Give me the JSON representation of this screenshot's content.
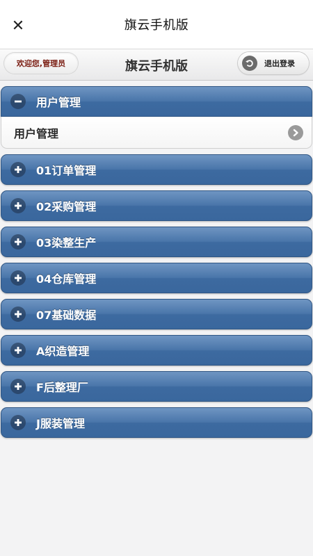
{
  "topbar": {
    "close_symbol": "✕",
    "title": "旗云手机版"
  },
  "header": {
    "welcome": "欢迎您,管理员",
    "title": "旗云手机版",
    "logout_label": "退出登录"
  },
  "menu": {
    "expanded": {
      "label": "用户管理",
      "sub_item": "用户管理"
    },
    "collapsed": [
      {
        "label": "01订单管理"
      },
      {
        "label": "02采购管理"
      },
      {
        "label": "03染整生产"
      },
      {
        "label": "04仓库管理"
      },
      {
        "label": "07基础数据"
      },
      {
        "label": "A织造管理"
      },
      {
        "label": "F后整理厂"
      },
      {
        "label": "J服装管理"
      }
    ]
  },
  "colors": {
    "section_blue": "#4a76aa",
    "welcome_text": "#7a1d12",
    "page_bg": "#f3f3f4"
  },
  "icons": {
    "close": "close-icon",
    "logout": "undo-arrow-icon",
    "expanded_toggle": "minus-circle-icon",
    "collapsed_toggle": "plus-circle-icon",
    "sub_item_arrow": "chevron-right-icon"
  }
}
